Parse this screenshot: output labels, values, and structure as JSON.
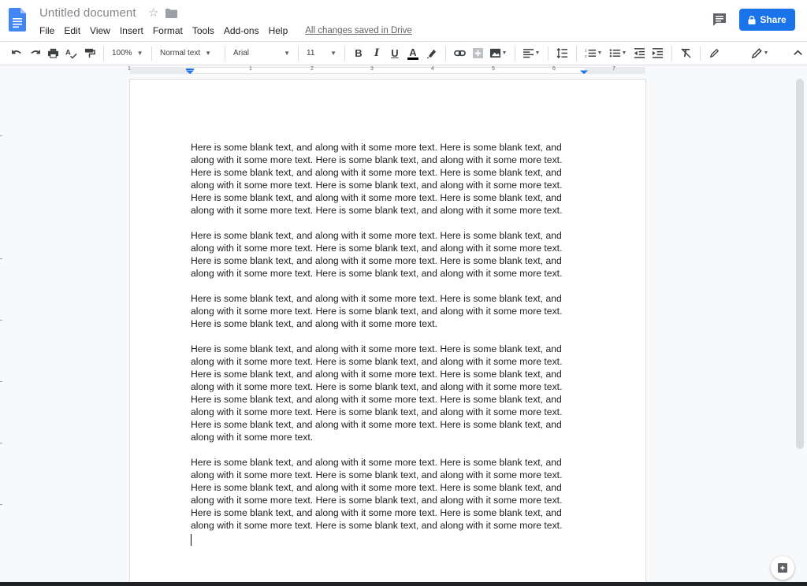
{
  "header": {
    "title": "Untitled document",
    "saved_status": "All changes saved in Drive",
    "share_label": "Share"
  },
  "menu": [
    "File",
    "Edit",
    "View",
    "Insert",
    "Format",
    "Tools",
    "Add-ons",
    "Help"
  ],
  "toolbar": {
    "zoom": "100%",
    "style": "Normal text",
    "font": "Arial",
    "font_size": "11",
    "bold": "B",
    "italic": "I",
    "underline": "U",
    "text_color": "A"
  },
  "ruler": {
    "numbers": [
      "1",
      "1",
      "2",
      "3",
      "4",
      "5",
      "6",
      "7"
    ]
  },
  "document": {
    "paragraphs": [
      "Here is some blank text, and along with it some more text. Here is some blank text, and along with it some more text. Here is some blank text, and along with it some more text. Here is some blank text, and along with it some more text. Here is some blank text, and along with it some more text. Here is some blank text, and along with it some more text. Here is some blank text, and along with it some more text. Here is some blank text, and along with it some more text. Here is some blank text, and along with it some more text.",
      "Here is some blank text, and along with it some more text. Here is some blank text, and along with it some more text. Here is some blank text, and along with it some more text. Here is some blank text, and along with it some more text. Here is some blank text, and along with it some more text. Here is some blank text, and along with it some more text.",
      "Here is some blank text, and along with it some more text. Here is some blank text, and along with it some more text. Here is some blank text, and along with it some more text. Here is some blank text, and along with it some more text.",
      "Here is some blank text, and along with it some more text. Here is some blank text, and along with it some more text. Here is some blank text, and along with it some more text. Here is some blank text, and along with it some more text. Here is some blank text, and along with it some more text. Here is some blank text, and along with it some more text. Here is some blank text, and along with it some more text. Here is some blank text, and along with it some more text. Here is some blank text, and along with it some more text. Here is some blank text, and along with it some more text. Here is some blank text, and along with it some more text.",
      "Here is some blank text, and along with it some more text. Here is some blank text, and along with it some more text. Here is some blank text, and along with it some more text. Here is some blank text, and along with it some more text. Here is some blank text, and along with it some more text. Here is some blank text, and along with it some more text. Here is some blank text, and along with it some more text. Here is some blank text, and along with it some more text. Here is some blank text, and along with it some more text."
    ]
  },
  "colors": {
    "accent": "#1a73e8",
    "doc_icon": "#4285f4"
  }
}
